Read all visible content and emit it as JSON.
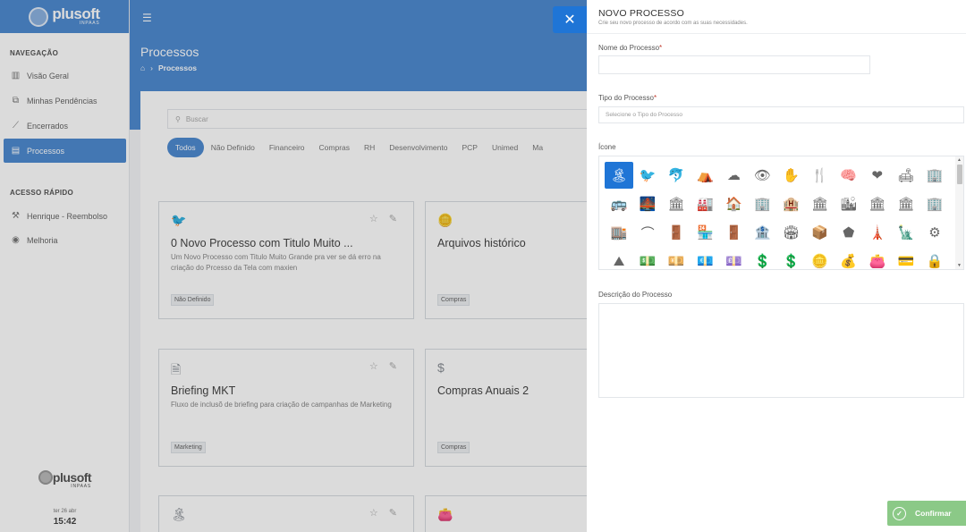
{
  "brand": {
    "name": "plusoft",
    "sub": "INPAAS"
  },
  "sidebar": {
    "section1": "NAVEGAÇÃO",
    "items": [
      {
        "label": "Visão Geral",
        "icon": "bar-chart-icon"
      },
      {
        "label": "Minhas Pendências",
        "icon": "copy-icon"
      },
      {
        "label": "Encerrados",
        "icon": "line-chart-icon"
      },
      {
        "label": "Processos",
        "icon": "inbox-icon",
        "active": true
      }
    ],
    "section2": "ACESSO RÁPIDO",
    "quick": [
      {
        "label": "Henrique - Reembolso",
        "icon": "hammer-icon"
      },
      {
        "label": "Melhoria",
        "icon": "globe-icon"
      }
    ],
    "date": "ter 26 abr",
    "time": "15:42"
  },
  "header": {
    "title": "Processos",
    "breadcrumb": [
      "Processos"
    ]
  },
  "search": {
    "placeholder": "Buscar"
  },
  "filters": [
    "Todos",
    "Não Definido",
    "Financeiro",
    "Compras",
    "RH",
    "Desenvolvimento",
    "PCP",
    "Unimed",
    "Ma"
  ],
  "cards": [
    {
      "title": "0 Novo Processo com Titulo Muito ...",
      "desc": "Um Novo Processo com Titulo Muito Grande pra ver se dá erro na criação do Prcesso da Tela com maxien",
      "tag": "Não Definido",
      "icon": "bird-icon"
    },
    {
      "title": "Arquivos histórico",
      "desc": "",
      "tag": "Compras",
      "icon": "coins-icon"
    },
    {
      "title": "Briefing MKT",
      "desc": "Fluxo de inclusõ de briefing para criação de campanhas de Marketing",
      "tag": "Marketing",
      "icon": "files-icon"
    },
    {
      "title": "Compras Anuais 2",
      "desc": "",
      "tag": "Compras",
      "icon": "dollar-circle-icon"
    },
    {
      "title": "",
      "desc": "",
      "tag": "",
      "icon": "beach-icon"
    },
    {
      "title": "",
      "desc": "",
      "tag": "",
      "icon": "wallet-icon"
    }
  ],
  "drawer": {
    "title": "NOVO PROCESSO",
    "subtitle": "Crie seu novo processo de acordo com as suas necessidades.",
    "name_label": "Nome do Processo",
    "type_label": "Tipo do Processo",
    "type_placeholder": "Selecione o Tipo do Processo",
    "icon_label": "Ícone",
    "desc_label": "Descrição do Processo",
    "required_mark": "*",
    "confirm": "Confirmar",
    "icons": [
      "🏝",
      "🐦",
      "🐬",
      "⛺",
      "☁",
      "👁",
      "✋",
      "🍴",
      "🧠",
      "❤",
      "🛋",
      "🏢",
      "🚌",
      "🌉",
      "🏛",
      "🏭",
      "🏠",
      "🏢",
      "🏨",
      "🏛",
      "🏙",
      "🏛",
      "🏛",
      "🏢",
      "🏬",
      "⌒",
      "🚪",
      "🏪",
      "🚪",
      "🏦",
      "🏟",
      "📦",
      "⬟",
      "🗼",
      "🗽",
      "⚙",
      "⛰",
      "💵",
      "💴",
      "💶",
      "💷",
      "💲",
      "💲",
      "🪙",
      "💰",
      "👛",
      "💳",
      "🔒"
    ]
  },
  "colors": {
    "primary": "#4f8bd1",
    "selected": "#1f75d6",
    "confirm": "#8bc987"
  }
}
